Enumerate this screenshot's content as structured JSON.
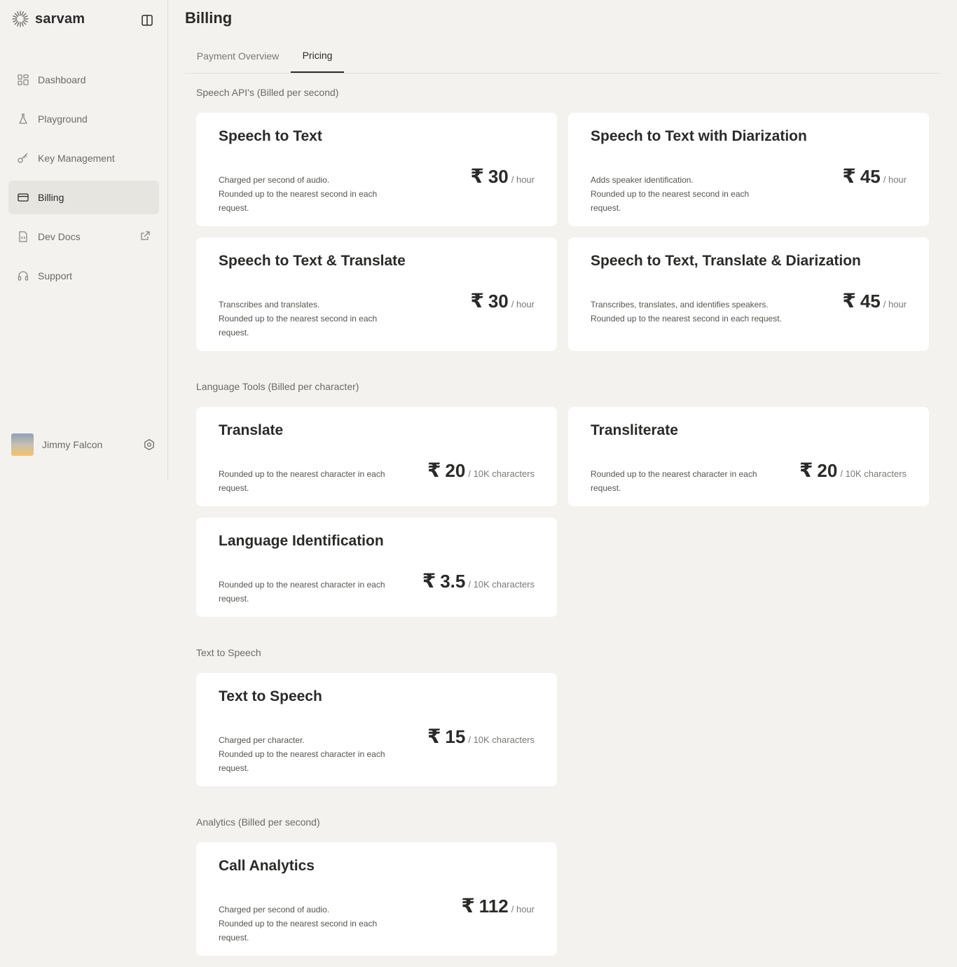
{
  "brand": {
    "name": "sarvam"
  },
  "sidebar": {
    "items": [
      {
        "label": "Dashboard",
        "icon": "dashboard-icon"
      },
      {
        "label": "Playground",
        "icon": "flask-icon"
      },
      {
        "label": "Key Management",
        "icon": "key-icon"
      },
      {
        "label": "Billing",
        "icon": "credit-card-icon",
        "active": true
      },
      {
        "label": "Dev Docs",
        "icon": "code-file-icon",
        "external": true
      },
      {
        "label": "Support",
        "icon": "headset-icon"
      }
    ]
  },
  "user": {
    "name": "Jimmy Falcon"
  },
  "page": {
    "title": "Billing"
  },
  "tabs": [
    {
      "label": "Payment Overview",
      "active": false
    },
    {
      "label": "Pricing",
      "active": true
    }
  ],
  "sections": [
    {
      "title": "Speech API's (Billed per second)",
      "cards": [
        {
          "title": "Speech to Text",
          "desc": [
            "Charged per second of audio.",
            "Rounded up to the nearest second in each request."
          ],
          "currency": "₹",
          "price": "30",
          "unit": "/ hour"
        },
        {
          "title": "Speech to Text with Diarization",
          "desc": [
            "Adds speaker identification.",
            "Rounded up to the nearest second in each request."
          ],
          "currency": "₹",
          "price": "45",
          "unit": "/ hour"
        },
        {
          "title": "Speech to Text & Translate",
          "desc": [
            "Transcribes and translates.",
            "Rounded up to the nearest second in each request."
          ],
          "currency": "₹",
          "price": "30",
          "unit": "/ hour"
        },
        {
          "title": "Speech to Text, Translate & Diarization",
          "desc": [
            "Transcribes, translates, and identifies speakers.",
            "Rounded up to the nearest second in each request."
          ],
          "currency": "₹",
          "price": "45",
          "unit": "/ hour"
        }
      ]
    },
    {
      "title": "Language Tools (Billed per character)",
      "cards": [
        {
          "title": "Translate",
          "desc": [
            "Rounded up to the nearest character in each request."
          ],
          "currency": "₹",
          "price": "20",
          "unit": "/ 10K characters"
        },
        {
          "title": "Transliterate",
          "desc": [
            "Rounded up to the nearest character in each request."
          ],
          "currency": "₹",
          "price": "20",
          "unit": "/ 10K characters"
        },
        {
          "title": "Language Identification",
          "desc": [
            "Rounded up to the nearest character in each request."
          ],
          "currency": "₹",
          "price": "3.5",
          "unit": "/ 10K characters"
        }
      ]
    },
    {
      "title": "Text to Speech",
      "cards": [
        {
          "title": "Text to Speech",
          "desc": [
            "Charged per character.",
            "Rounded up to the nearest character in each request."
          ],
          "currency": "₹",
          "price": "15",
          "unit": "/ 10K characters"
        }
      ]
    },
    {
      "title": "Analytics (Billed per second)",
      "cards": [
        {
          "title": "Call Analytics",
          "desc": [
            "Charged per second of audio.",
            "Rounded up to the nearest second in each request."
          ],
          "currency": "₹",
          "price": "112",
          "unit": "/ hour"
        }
      ]
    }
  ]
}
